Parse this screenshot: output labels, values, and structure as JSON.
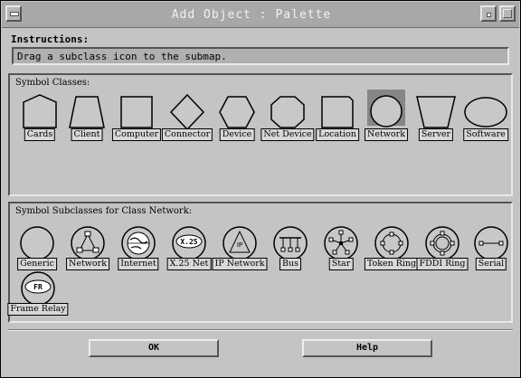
{
  "window": {
    "title": "Add Object : Palette"
  },
  "instructions": {
    "label": "Instructions:",
    "text": "Drag a subclass icon to the submap."
  },
  "classes": {
    "label": "Symbol Classes:",
    "items": [
      {
        "label": "Cards",
        "shape": "pentagon"
      },
      {
        "label": "Client",
        "shape": "trapezoid"
      },
      {
        "label": "Computer",
        "shape": "square"
      },
      {
        "label": "Connector",
        "shape": "diamond"
      },
      {
        "label": "Device",
        "shape": "hexagon"
      },
      {
        "label": "Net Device",
        "shape": "octagon"
      },
      {
        "label": "Location",
        "shape": "notched-square"
      },
      {
        "label": "Network",
        "shape": "circle",
        "selected": true
      },
      {
        "label": "Server",
        "shape": "inverted-trapezoid"
      },
      {
        "label": "Software",
        "shape": "ellipse"
      }
    ]
  },
  "subclasses": {
    "label": "Symbol Subclasses for Class Network:",
    "items": [
      {
        "label": "Generic",
        "icon": "generic-icon"
      },
      {
        "label": "Network",
        "icon": "network-icon"
      },
      {
        "label": "Internet",
        "icon": "globe-icon"
      },
      {
        "label": "X.25 Net",
        "icon": "x25-icon",
        "icon_text": "X.25"
      },
      {
        "label": "IP Network",
        "icon": "ip-network-icon",
        "icon_text": "IP"
      },
      {
        "label": "Bus",
        "icon": "bus-icon"
      },
      {
        "label": "Star",
        "icon": "star-icon"
      },
      {
        "label": "Token Ring",
        "icon": "token-ring-icon"
      },
      {
        "label": "FDDI Ring",
        "icon": "fddi-ring-icon"
      },
      {
        "label": "Serial",
        "icon": "serial-icon"
      },
      {
        "label": "Frame Relay",
        "icon": "frame-relay-icon",
        "icon_text": "FR"
      }
    ]
  },
  "buttons": {
    "ok": "OK",
    "help": "Help"
  }
}
